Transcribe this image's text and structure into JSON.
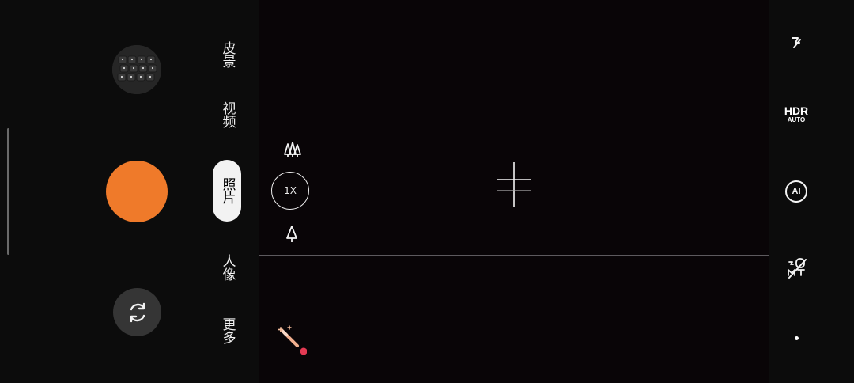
{
  "modes": [
    {
      "label": "皮景",
      "active": false
    },
    {
      "label": "视频",
      "active": false
    },
    {
      "label": "照片",
      "active": true
    },
    {
      "label": "人像",
      "active": false
    },
    {
      "label": "更多",
      "active": false
    }
  ],
  "zoom": {
    "current": "1X",
    "wide_icon": "trees-icon",
    "tele_icon": "tree-icon"
  },
  "right_controls": {
    "flash_icon": "flash-off-icon",
    "hdr_top": "HDR",
    "hdr_bottom": "AUTO",
    "ai_label": "AI",
    "macro_icon": "macro-mode-icon",
    "more_icon": "dot-icon"
  },
  "left_controls": {
    "gallery_icon": "gallery-thumbnail",
    "shutter_color": "#ef7a2a",
    "switch_camera_icon": "switch-camera-icon"
  },
  "viewfinder": {
    "grid_enabled": true,
    "focus_icon": "focus-crosshair-icon",
    "effects_icon": "magic-wand-icon",
    "effects_badge_color": "#e43a53"
  }
}
